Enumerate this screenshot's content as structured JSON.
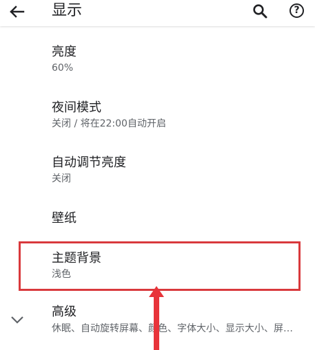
{
  "appbar": {
    "title": "显示",
    "icons": {
      "back": "arrow-left-icon",
      "search": "search-icon",
      "help": "help-circle-icon"
    },
    "help_glyph": "?"
  },
  "settings": {
    "brightness": {
      "title": "亮度",
      "summary": "60%"
    },
    "night_mode": {
      "title": "夜间模式",
      "summary": "关闭 / 将在22:00自动开启"
    },
    "auto_brightness": {
      "title": "自动调节亮度",
      "summary": "关闭"
    },
    "wallpaper": {
      "title": "壁纸"
    },
    "theme": {
      "title": "主题背景",
      "summary": "浅色"
    },
    "advanced": {
      "title": "高级",
      "summary": "休眠、自动旋转屏幕、颜色、字体大小、显示大小、屏幕保护程序",
      "icon": "chevron-down-icon"
    }
  },
  "annotation": {
    "highlight_color": "#d9393c",
    "arrow_color": "#e8343a"
  }
}
